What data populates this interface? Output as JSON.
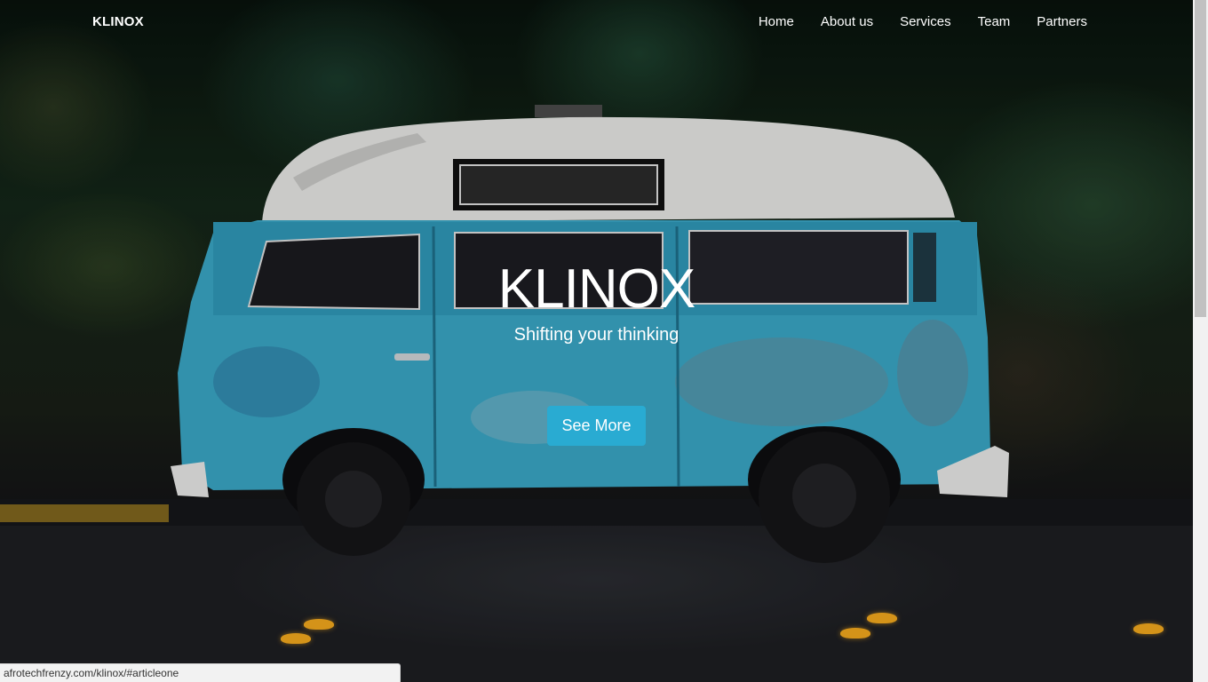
{
  "brand": "KLINOX",
  "nav": {
    "items": [
      {
        "label": "Home"
      },
      {
        "label": "About us"
      },
      {
        "label": "Services"
      },
      {
        "label": "Team"
      },
      {
        "label": "Partners"
      }
    ]
  },
  "hero": {
    "title": "KLINOX",
    "subtitle": "Shifting your thinking",
    "button_label": "See More"
  },
  "status_bar": {
    "url": "afrotechfrenzy.com/klinox/#articleone"
  },
  "colors": {
    "accent": "#29abd2",
    "van_body": "#3aa6c4",
    "van_roof": "#e6e6e4"
  }
}
